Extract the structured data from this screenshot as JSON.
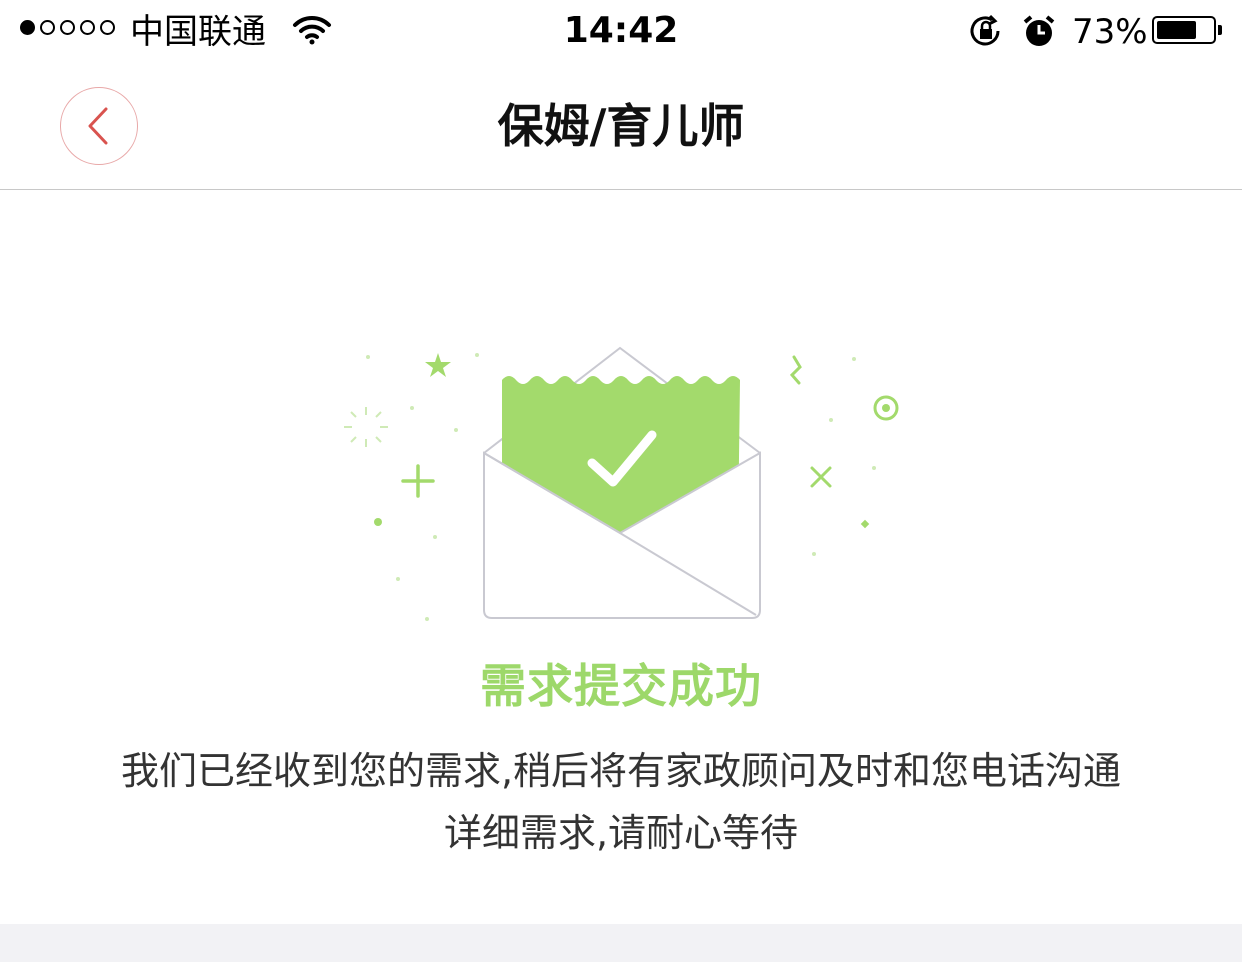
{
  "status_bar": {
    "carrier": "中国联通",
    "time": "14:42",
    "battery_percent": "73%",
    "battery_level": 0.73,
    "signal_bars_filled": 1,
    "signal_bars_total": 5
  },
  "nav": {
    "title": "保姆/育儿师",
    "back_icon": "chevron-left-icon"
  },
  "main": {
    "success_title": "需求提交成功",
    "message_line1": "我们已经收到您的需求,稍后将有家政顾问及时和您电话沟通",
    "message_line2": "详细需求,请耐心等待"
  },
  "colors": {
    "accent_green": "#9dd86a",
    "back_button_red": "#d9534f",
    "envelope_outline": "#c9c9d1"
  }
}
